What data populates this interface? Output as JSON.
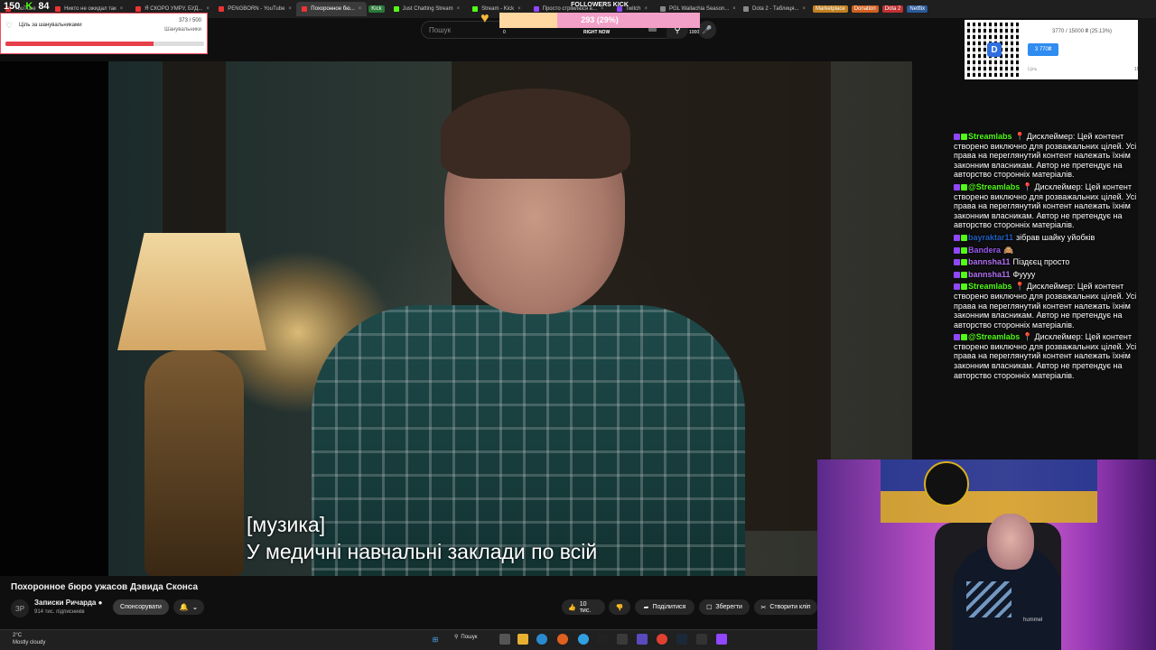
{
  "browser": {
    "tabs": [
      {
        "label": "YouTube",
        "color": "#e33"
      },
      {
        "label": "Никто не ожидал так",
        "color": "#e33"
      },
      {
        "label": "Я СКОРО УМРУ, БУД...",
        "color": "#e33"
      },
      {
        "label": "PENGBORN - YouTube",
        "color": "#e33"
      },
      {
        "label": "Похоронное бю...",
        "color": "#e33",
        "active": true
      },
      {
        "label": "Just Chatting Stream",
        "color": "#53fc18"
      },
      {
        "label": "Stream - Kick",
        "color": "#53fc18"
      },
      {
        "label": "Просто стрімлюся в...",
        "color": "#9146ff"
      },
      {
        "label": "Twitch",
        "color": "#9146ff"
      },
      {
        "label": "PGL Wallachia Season...",
        "color": "#888"
      },
      {
        "label": "Dota 2 - Таблиця...",
        "color": "#888"
      }
    ],
    "pills": [
      {
        "label": "Kick",
        "color": "#2a7a3a"
      },
      {
        "label": "Marketplace",
        "color": "#c08020"
      },
      {
        "label": "Donation",
        "color": "#d06020"
      },
      {
        "label": "Dota 2",
        "color": "#c03030"
      },
      {
        "label": "Netflix",
        "color": "#2a5a9a"
      }
    ]
  },
  "overlay": {
    "stat_viewers": "150",
    "stat_kick": "84",
    "goal": {
      "title": "Ціль за шанувальниками",
      "count": "373 / 500",
      "sub": "Шанувальники",
      "progress": 0.746
    },
    "followers": {
      "title": "FOLLOWERS KICK",
      "value": "293 (29%)",
      "progress": 0.29,
      "min": "0",
      "mid": "RIGHT NOW",
      "max": "1000"
    },
    "donation": {
      "text": "3770 / 15000 ₴ (25.13%)",
      "button": "3 770₴",
      "min": "Ціль",
      "max": "15 000₴"
    }
  },
  "youtube": {
    "search_placeholder": "Пошук",
    "subtitle_line1": "[музика]",
    "subtitle_line2": "У медичні навчальні заклади по всій",
    "video_title": "Похоронное бюро ужасов Дэвида Сконса",
    "channel_name": "Записки Ричарда",
    "channel_initials": "ЗР",
    "subscribers": "914 тис. підписників",
    "sponsor_label": "Спонсорувати",
    "like_count": "10 тис.",
    "share_label": "Поділитися",
    "save_label": "Зберегти",
    "clip_label": "Створити кліп"
  },
  "chat": {
    "messages": [
      {
        "user": "Streamlabs",
        "color": "#53fc18",
        "text": "Дисклеймер: Цей контент створено виключно для розважальних цілей. Усі права на переглянутий контент належать їхнім законним власникам. Автор не претендує на авторство сторонніх матеріалів.",
        "pin": true
      },
      {
        "user": "@Streamlabs",
        "color": "#53fc18",
        "text": "Дисклеймер: Цей контент створено виключно для розважальних цілей. Усі права на переглянутий контент належать їхнім законним власникам. Автор не претендує на авторство сторонніх матеріалів.",
        "pin": true
      },
      {
        "user": "bayraktar11",
        "color": "#2060c0",
        "text": "зібрав шайку уйобків",
        "pin": false
      },
      {
        "user": "Bandera",
        "color": "#9b59f0",
        "text": "🙈",
        "pin": false
      },
      {
        "user": "bannsha11",
        "color": "#b070f0",
        "text": "Піздєєц просто",
        "pin": false
      },
      {
        "user": "bannsha11",
        "color": "#b070f0",
        "text": "Фуууу",
        "pin": false
      },
      {
        "user": "Streamlabs",
        "color": "#53fc18",
        "text": "Дисклеймер: Цей контент створено виключно для розважальних цілей. Усі права на переглянутий контент належать їхнім законним власникам. Автор не претендує на авторство сторонніх матеріалів.",
        "pin": true
      },
      {
        "user": "@Streamlabs",
        "color": "#53fc18",
        "text": "Дисклеймер: Цей контент створено виключно для розважальних цілей. Усі права на переглянутий контент належать їхнім законним власникам. Автор не претендує на авторство сторонніх матеріалів.",
        "pin": true
      }
    ]
  },
  "taskbar": {
    "weather_temp": "2°C",
    "weather_desc": "Mostly cloudy",
    "search_label": "Пошук"
  },
  "webcam": {
    "label": "hummel"
  }
}
